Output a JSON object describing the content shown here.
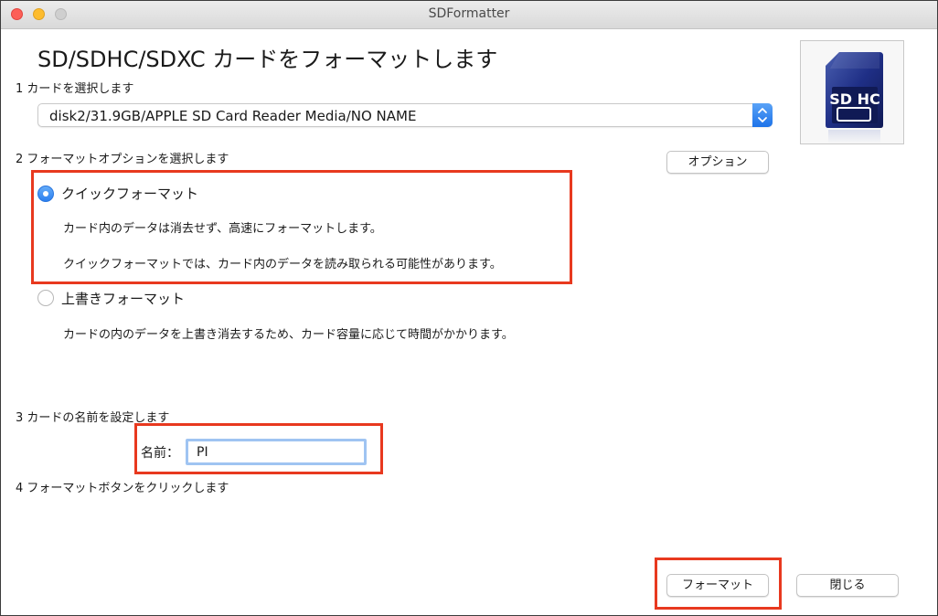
{
  "window": {
    "title": "SDFormatter"
  },
  "heading": "SD/SDHC/SDXC カードをフォーマットします",
  "step1": {
    "label": "1 カードを選択します",
    "card_selected": "disk2/31.9GB/APPLE SD Card Reader Media/NO NAME"
  },
  "step2": {
    "label": "2 フォーマットオプションを選択します",
    "options_button": "オプション",
    "quick": {
      "label": "クイックフォーマット",
      "desc1": "カード内のデータは消去せず、高速にフォーマットします。",
      "desc2": "クイックフォーマットでは、カード内のデータを読み取られる可能性があります。",
      "selected": true
    },
    "overwrite": {
      "label": "上書きフォーマット",
      "desc": "カードの内のデータを上書き消去するため、カード容量に応じて時間がかかります。",
      "selected": false
    }
  },
  "step3": {
    "label": "3 カードの名前を設定します",
    "name_label": "名前：",
    "name_value": "PI"
  },
  "step4": {
    "label": "4 フォーマットボタンをクリックします"
  },
  "buttons": {
    "format": "フォーマット",
    "close": "閉じる"
  },
  "sd_icon_text": "SD HC",
  "colors": {
    "highlight": "#e8391f",
    "accent": "#2b7ff0",
    "focus_ring": "#9fc4f2"
  }
}
